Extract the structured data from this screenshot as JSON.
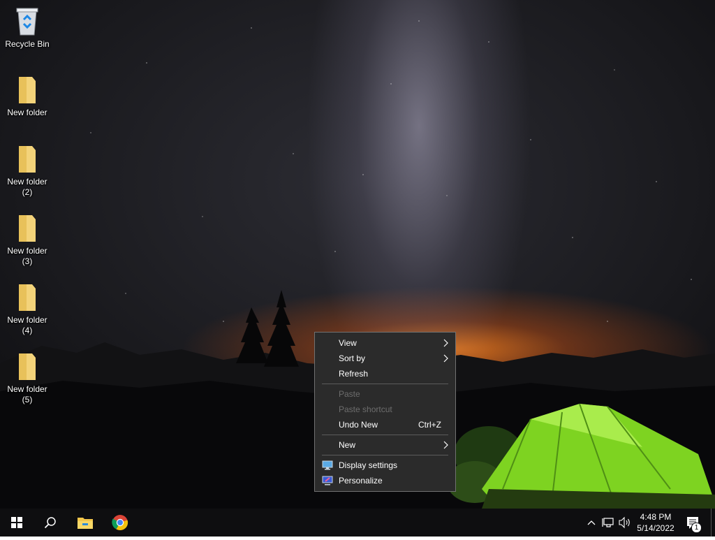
{
  "desktop_icons": [
    {
      "label": "Recycle Bin",
      "icon": "recycle-bin-icon"
    },
    {
      "label": "New folder",
      "icon": "folder-icon"
    },
    {
      "label": "New folder (2)",
      "icon": "folder-icon"
    },
    {
      "label": "New folder (3)",
      "icon": "folder-icon"
    },
    {
      "label": "New folder (4)",
      "icon": "folder-icon"
    },
    {
      "label": "New folder (5)",
      "icon": "folder-icon"
    }
  ],
  "context_menu": {
    "view": "View",
    "sort_by": "Sort by",
    "refresh": "Refresh",
    "paste": "Paste",
    "paste_shortcut": "Paste shortcut",
    "undo_new": "Undo New",
    "undo_shortcut": "Ctrl+Z",
    "new": "New",
    "display_settings": "Display settings",
    "personalize": "Personalize"
  },
  "taskbar": {
    "time": "4:48 PM",
    "date": "5/14/2022",
    "notification_count": "1",
    "pinned": [
      "start-icon",
      "search-icon",
      "file-explorer-icon",
      "chrome-icon"
    ]
  },
  "colors": {
    "menu_bg": "#2b2b2b",
    "taskbar_bg": "#0e0e10",
    "tent_green": "#7ed321"
  }
}
